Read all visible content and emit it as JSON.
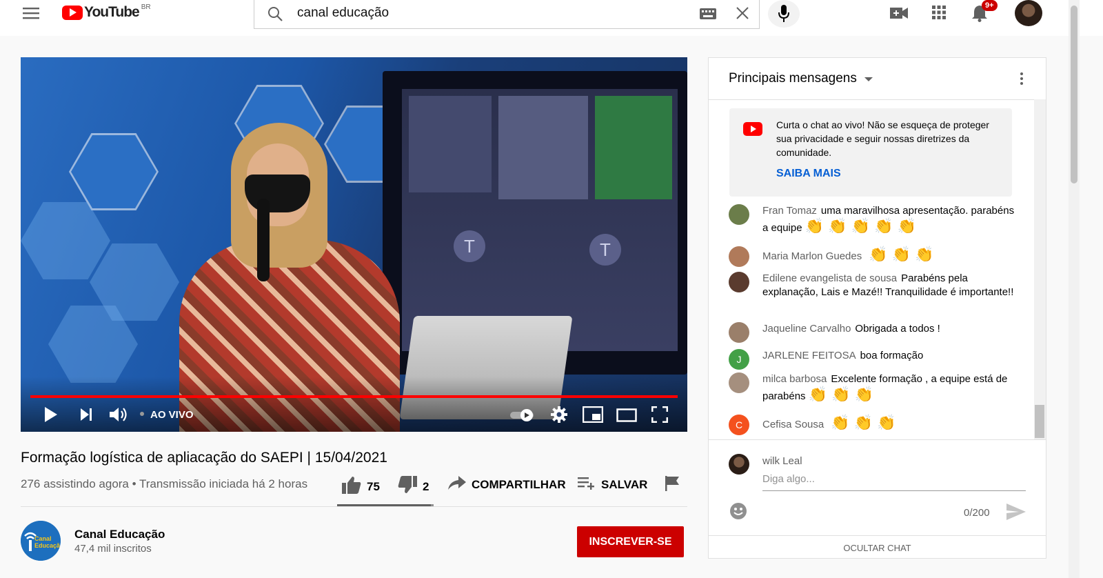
{
  "masthead": {
    "logo_text": "YouTube",
    "country_code": "BR",
    "search_value": "canal educação",
    "notification_badge": "9+"
  },
  "video": {
    "live_label": "AO VIVO",
    "title": "Formação logística de apliacação do SAEPI | 15/04/2021",
    "meta": "276 assistindo agora • Transmissão iniciada há 2 horas",
    "likes": "75",
    "dislikes": "2",
    "share_label": "COMPARTILHAR",
    "save_label": "SALVAR",
    "monitor_letter": "T"
  },
  "channel": {
    "name": "Canal Educação",
    "subscribers": "47,4 mil inscritos",
    "subscribe_label": "INSCREVER-SE",
    "avatar_text": "Canal Educação"
  },
  "chat": {
    "title": "Principais mensagens",
    "banner_text": "Curta o chat ao vivo! Não se esqueça de proteger sua privacidade e seguir nossas diretrizes da comunidade.",
    "banner_link": "SAIBA MAIS",
    "messages": [
      {
        "author": "Fran Tomaz",
        "text": "uma maravilhosa apresentação. parabéns a equipe",
        "emoji": "👏 👏 👏 👏 👏",
        "avatar_color": "#6b7d4a"
      },
      {
        "author": "Maria Marlon Guedes",
        "text": "",
        "emoji": "👏 👏 👏",
        "avatar_color": "#b07a5a"
      },
      {
        "author": "Edilene evangelista de sousa",
        "text": "Parabéns pela explanação, Lais e Mazé!! Tranquilidade é importante!!",
        "emoji": "",
        "avatar_color": "#5a3b2e"
      },
      {
        "author": "Jaqueline Carvalho",
        "text": "Obrigada a todos !",
        "emoji": "",
        "avatar_color": "#9a7f6a"
      },
      {
        "author": "JARLENE FEITOSA",
        "text": "boa formação",
        "emoji": "",
        "avatar_color": "#43a047",
        "initial": "J"
      },
      {
        "author": "milca barbosa",
        "text": "Excelente formação , a equipe está de parabéns",
        "emoji": "👏 👏 👏",
        "avatar_color": "#a58f7e"
      },
      {
        "author": "Cefisa Sousa",
        "text": "",
        "emoji": "👏 👏 👏",
        "avatar_color": "#f4511e",
        "initial": "C"
      }
    ],
    "current_user": "wilk Leal",
    "input_placeholder": "Diga algo...",
    "char_counter": "0/200",
    "hide_chat_label": "OCULTAR CHAT"
  },
  "colors": {
    "brand_red": "#ff0000",
    "subscribe_red": "#cc0000",
    "link_blue": "#065fd4"
  },
  "icons": [
    "menu-icon",
    "youtube-logo-icon",
    "search-icon",
    "keyboard-icon",
    "clear-icon",
    "mic-icon",
    "create-video-icon",
    "apps-icon",
    "bell-icon",
    "play-icon",
    "next-icon",
    "volume-icon",
    "autoplay-toggle-icon",
    "settings-icon",
    "miniplayer-icon",
    "theater-icon",
    "fullscreen-icon",
    "like-icon",
    "dislike-icon",
    "share-icon",
    "save-playlist-icon",
    "flag-icon",
    "dropdown-icon",
    "more-vert-icon",
    "emoji-icon",
    "send-icon"
  ]
}
